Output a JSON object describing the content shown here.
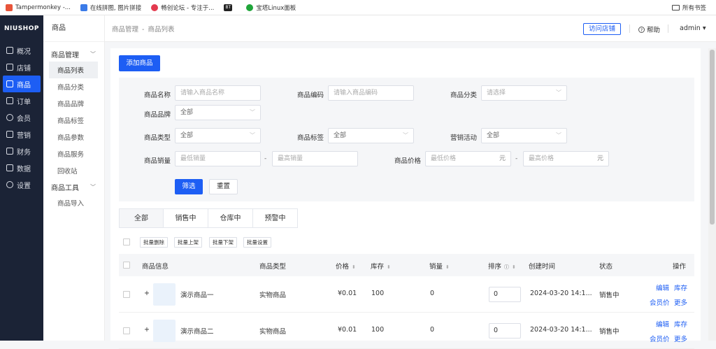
{
  "bookmarks": {
    "items": [
      {
        "label": "Tampermonkey -...",
        "color": "#e8543a"
      },
      {
        "label": "在线拼图, 图片拼接",
        "color": "#3b7be8"
      },
      {
        "label": "畅创论坛 - 专注于...",
        "color": "#e33a4f"
      },
      {
        "label": "BT",
        "color": "#222222"
      },
      {
        "label": "宝塔Linux面板",
        "color": "#20a53a"
      }
    ],
    "all_label": "所有书签"
  },
  "nav": {
    "logo": "NIUSHOP",
    "items": [
      {
        "label": "概况"
      },
      {
        "label": "店铺"
      },
      {
        "label": "商品"
      },
      {
        "label": "订单"
      },
      {
        "label": "会员"
      },
      {
        "label": "营销"
      },
      {
        "label": "财务"
      },
      {
        "label": "数据"
      },
      {
        "label": "设置"
      }
    ],
    "accent": "#1d5ef4"
  },
  "sub": {
    "title": "商品",
    "group1": "商品管理",
    "items1": [
      "商品列表",
      "商品分类",
      "商品品牌",
      "商品标签",
      "商品参数",
      "商品服务",
      "回收站"
    ],
    "group2": "商品工具",
    "items2": [
      "商品导入"
    ]
  },
  "top": {
    "crumb1": "商品管理",
    "crumb_sep": "-",
    "crumb2": "商品列表",
    "visit": "访问店铺",
    "help": "帮助",
    "admin": "admin"
  },
  "add_button": "添加商品",
  "filter": {
    "name_label": "商品名称",
    "name_ph": "请输入商品名称",
    "code_label": "商品编码",
    "code_ph": "请输入商品编码",
    "cat_label": "商品分类",
    "cat_ph": "请选择",
    "brand_label": "商品品牌",
    "brand_val": "全部",
    "type_label": "商品类型",
    "type_val": "全部",
    "tag_label": "商品标签",
    "tag_val": "全部",
    "promo_label": "营销活动",
    "promo_val": "全部",
    "sales_label": "商品销量",
    "sales_min": "最低销量",
    "sales_max": "最高销量",
    "price_label": "商品价格",
    "price_min": "最低价格",
    "price_max": "最高价格",
    "unit": "元",
    "dash": "-",
    "search": "筛选",
    "reset": "重置"
  },
  "tabs": [
    "全部",
    "销售中",
    "仓库中",
    "预警中"
  ],
  "batch": [
    "批量删除",
    "批量上架",
    "批量下架",
    "批量设置"
  ],
  "table": {
    "headers": {
      "info": "商品信息",
      "type": "商品类型",
      "price": "价格",
      "stock": "库存",
      "sales": "销量",
      "sort": "排序",
      "time": "创建时间",
      "status": "状态",
      "ops": "操作"
    },
    "rows": [
      {
        "expand": "+",
        "name": "演示商品一",
        "type": "实物商品",
        "price": "¥0.01",
        "stock": "100",
        "sales": "0",
        "sort": "0",
        "time": "2024-03-20 14:1...",
        "status": "销售中"
      },
      {
        "expand": "+",
        "name": "演示商品二",
        "type": "实物商品",
        "price": "¥0.01",
        "stock": "100",
        "sales": "0",
        "sort": "0",
        "time": "2024-03-20 14:1...",
        "status": "销售中"
      }
    ],
    "ops": {
      "edit": "编辑",
      "stock": "库存",
      "member": "会员价",
      "more": "更多"
    }
  }
}
